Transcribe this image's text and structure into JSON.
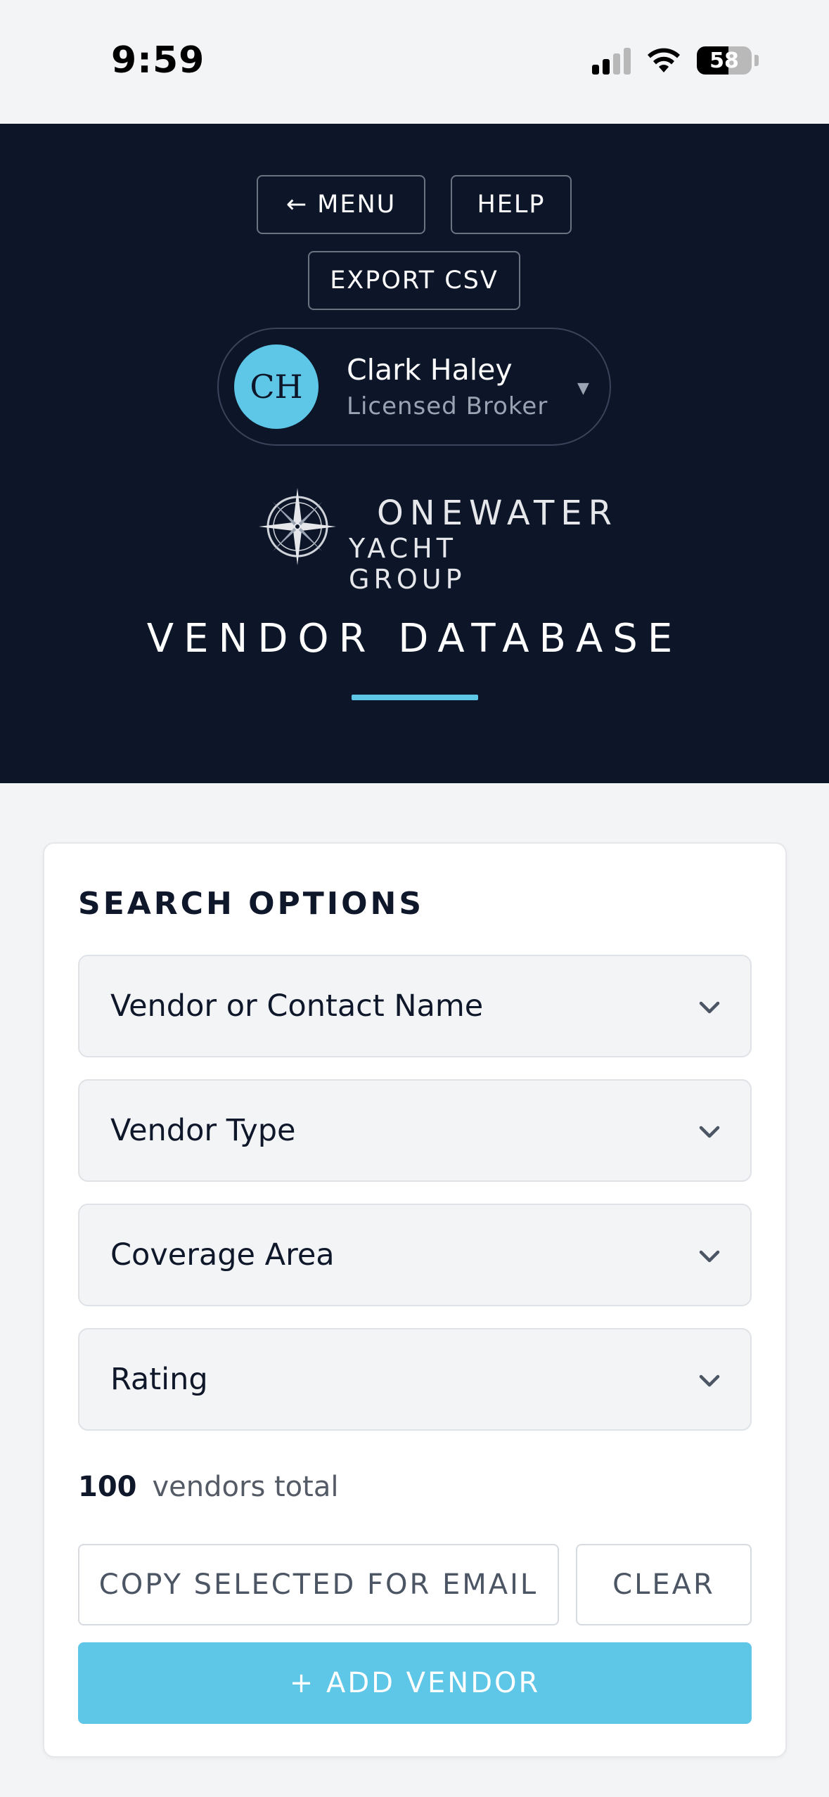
{
  "status_bar": {
    "time": "9:59",
    "battery_percent": "58",
    "battery_level": 0.58
  },
  "header": {
    "menu_label": "← MENU",
    "help_label": "HELP",
    "export_label": "EXPORT CSV",
    "user": {
      "initials": "CH",
      "name": "Clark Haley",
      "role": "Licensed Broker"
    },
    "logo": {
      "line1": "ONEWATER",
      "line2": "YACHT GROUP"
    },
    "page_title": "VENDOR DATABASE"
  },
  "search": {
    "title": "SEARCH OPTIONS",
    "filters": [
      {
        "label": "Vendor or Contact Name"
      },
      {
        "label": "Vendor Type"
      },
      {
        "label": "Coverage Area"
      },
      {
        "label": "Rating"
      }
    ],
    "total_count": "100",
    "total_label": "vendors total",
    "copy_label": "COPY SELECTED FOR EMAIL",
    "clear_label": "CLEAR",
    "add_label": "+ ADD VENDOR"
  },
  "colors": {
    "header_bg": "#0d1628",
    "accent": "#5ec6e6",
    "page_bg": "#f3f4f6"
  }
}
